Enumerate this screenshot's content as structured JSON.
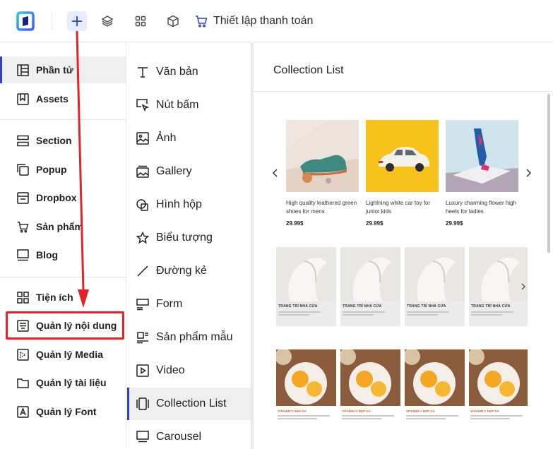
{
  "topbar": {
    "checkout_label": "Thiết lập thanh toán"
  },
  "sidebar": {
    "items": [
      {
        "label": "Phần tử",
        "icon": "elements-icon",
        "active": true
      },
      {
        "label": "Assets",
        "icon": "bookmark-icon"
      },
      {
        "label": "Section",
        "icon": "section-icon"
      },
      {
        "label": "Popup",
        "icon": "popup-icon"
      },
      {
        "label": "Dropbox",
        "icon": "dropbox-icon"
      },
      {
        "label": "Sản phẩm",
        "icon": "cart-icon"
      },
      {
        "label": "Blog",
        "icon": "blog-icon"
      },
      {
        "label": "Tiện ích",
        "icon": "widgets-icon"
      },
      {
        "label": "Quản lý nội dung",
        "icon": "content-manager-icon",
        "highlighted": true
      },
      {
        "label": "Quản lý Media",
        "icon": "media-icon"
      },
      {
        "label": "Quản lý tài liệu",
        "icon": "folder-icon"
      },
      {
        "label": "Quản lý Font",
        "icon": "font-icon"
      }
    ]
  },
  "elements": {
    "items": [
      {
        "label": "Văn bản",
        "icon": "text-icon"
      },
      {
        "label": "Nút bấm",
        "icon": "button-cursor-icon"
      },
      {
        "label": "Ảnh",
        "icon": "image-icon"
      },
      {
        "label": "Gallery",
        "icon": "gallery-icon"
      },
      {
        "label": "Hình hộp",
        "icon": "shape-icon"
      },
      {
        "label": "Biểu tượng",
        "icon": "star-icon"
      },
      {
        "label": "Đường kẻ",
        "icon": "line-icon"
      },
      {
        "label": "Form",
        "icon": "form-icon"
      },
      {
        "label": "Sản phẩm mẫu",
        "icon": "sample-product-icon"
      },
      {
        "label": "Video",
        "icon": "video-icon"
      },
      {
        "label": "Collection List",
        "icon": "collection-icon",
        "active": true
      },
      {
        "label": "Carousel",
        "icon": "carousel-icon"
      }
    ]
  },
  "preview": {
    "title": "Collection List",
    "products": [
      {
        "name": "High quality leathered green shoes for mens",
        "price": "29.99$",
        "bg": "#efe6de"
      },
      {
        "name": "Lightning white car toy for junior kids",
        "price": "29.99$",
        "bg": "#f6c21b"
      },
      {
        "name": "Luxury charming flower high heels for ladies",
        "price": "29.99$",
        "bg": "#cfe4ec"
      }
    ],
    "vase_cards": [
      {
        "title": "TRANG TRÍ NHÀ CỬA"
      },
      {
        "title": "TRANG TRÍ NHÀ CỬA"
      },
      {
        "title": "TRANG TRÍ NHÀ CỬA"
      },
      {
        "title": "TRANG TRÍ NHÀ CỬA"
      }
    ],
    "food_cards": [
      {
        "title": "VITAMIN C ĐẸP DA"
      },
      {
        "title": "VITAMIN C ĐẸP DA"
      },
      {
        "title": "VITAMIN C ĐẸP DA"
      },
      {
        "title": "VITAMIN C ĐẸP DA"
      }
    ]
  },
  "colors": {
    "accent": "#2f3fc9",
    "annotation_red": "#e4222a"
  }
}
